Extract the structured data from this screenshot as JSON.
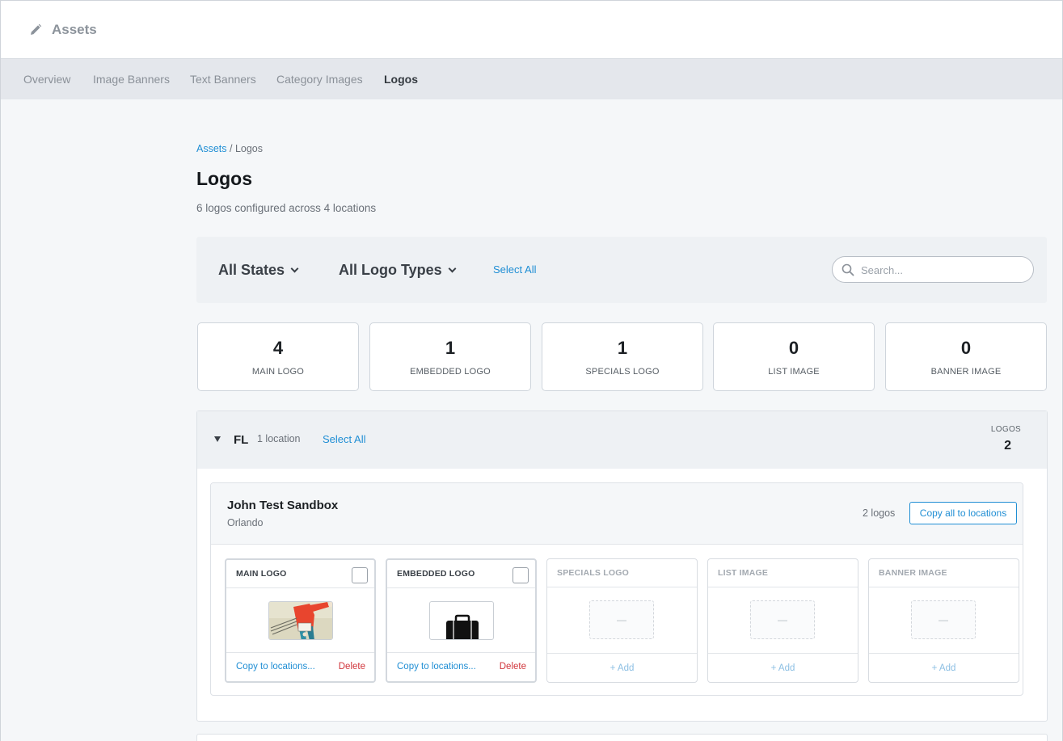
{
  "header": {
    "title": "Assets",
    "icon": "pencil-icon"
  },
  "nav": {
    "tabs": [
      {
        "label": "Overview"
      },
      {
        "label": "Image Banners"
      },
      {
        "label": "Text Banners"
      },
      {
        "label": "Category Images"
      },
      {
        "label": "Logos",
        "active": true
      }
    ]
  },
  "breadcrumb": {
    "root": "Assets",
    "sep": " / ",
    "current": "Logos"
  },
  "page": {
    "title": "Logos",
    "subtitle": "6 logos configured across 4 locations"
  },
  "filters": {
    "states": "All States",
    "types": "All Logo Types",
    "select_all": "Select All",
    "search_placeholder": "Search...",
    "search_value": ""
  },
  "stats": [
    {
      "num": "4",
      "label": "MAIN LOGO"
    },
    {
      "num": "1",
      "label": "EMBEDDED LOGO"
    },
    {
      "num": "1",
      "label": "SPECIALS LOGO"
    },
    {
      "num": "0",
      "label": "LIST IMAGE"
    },
    {
      "num": "0",
      "label": "BANNER IMAGE"
    }
  ],
  "group": {
    "state": "FL",
    "locations": "1 location",
    "select_all": "Select All",
    "count_label": "LOGOS",
    "count": "2",
    "location": {
      "name": "John Test Sandbox",
      "city": "Orlando",
      "logo_count": "2 logos",
      "copy_all": "Copy all to locations",
      "cards": [
        {
          "title": "MAIN LOGO",
          "filled": true,
          "copy": "Copy to locations...",
          "delete": "Delete"
        },
        {
          "title": "EMBEDDED LOGO",
          "filled": true,
          "copy": "Copy to locations...",
          "delete": "Delete"
        },
        {
          "title": "SPECIALS LOGO",
          "filled": false,
          "placeholder": "—",
          "add": "+ Add"
        },
        {
          "title": "LIST IMAGE",
          "filled": false,
          "placeholder": "—",
          "add": "+ Add"
        },
        {
          "title": "BANNER IMAGE",
          "filled": false,
          "placeholder": "—",
          "add": "+ Add"
        }
      ]
    }
  },
  "colors": {
    "accent": "#1f8ed4",
    "danger": "#d0343a",
    "nav_bg": "#e4e7ec",
    "page_bg": "#f5f7f9"
  }
}
